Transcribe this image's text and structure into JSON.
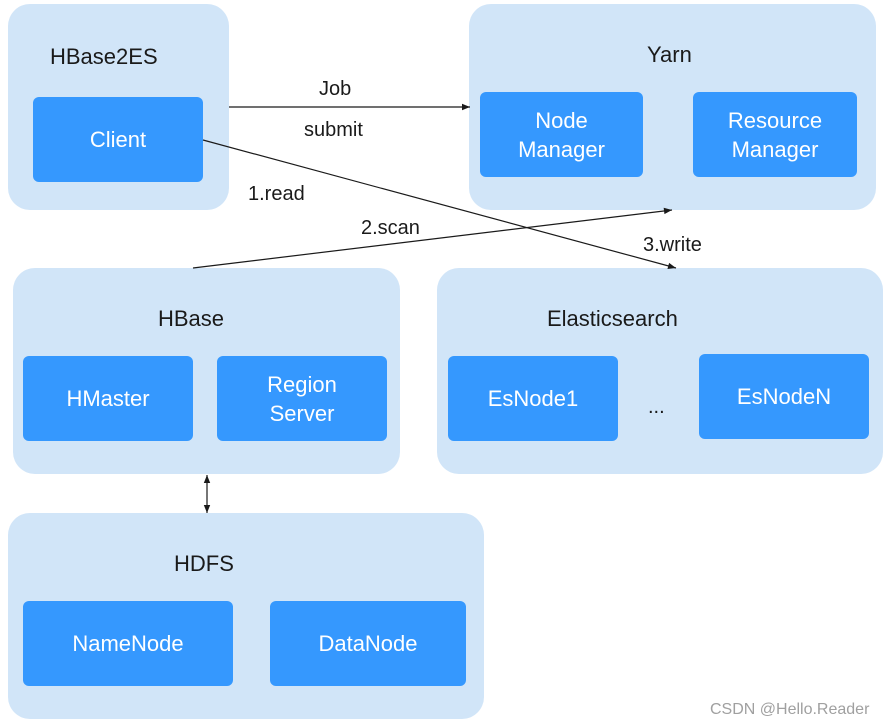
{
  "colors": {
    "group_fill": "#d1e5f8",
    "node_fill": "#3598fe",
    "node_text": "#ffffff",
    "title_text": "#1a1a1a",
    "edge": "#1a1a1a",
    "watermark": "#a0a0a0"
  },
  "groups": {
    "hbase2es": {
      "title": "HBase2ES",
      "nodes": [
        "Client"
      ]
    },
    "yarn": {
      "title": "Yarn",
      "nodes": [
        "Node\nManager",
        "Resource\nManager"
      ]
    },
    "hbase": {
      "title": "HBase",
      "nodes": [
        "HMaster",
        "Region\nServer"
      ]
    },
    "elasticsearch": {
      "title": "Elasticsearch",
      "nodes": [
        "EsNode1",
        "EsNodeN"
      ],
      "ellipsis": "..."
    },
    "hdfs": {
      "title": "HDFS",
      "nodes": [
        "NameNode",
        "DataNode"
      ]
    }
  },
  "edges": [
    {
      "from": "Client",
      "to": "Yarn",
      "label_above": "Job",
      "label_below": "submit",
      "direction": "forward"
    },
    {
      "from": "Client",
      "to": "Elasticsearch",
      "label": "1.read / 3.write",
      "direction": "forward"
    },
    {
      "from": "HBase",
      "to": "Yarn",
      "label": "2.scan",
      "direction": "forward"
    },
    {
      "from": "HBase",
      "to": "HDFS",
      "label": "",
      "direction": "bidirectional"
    }
  ],
  "edge_labels": {
    "job": "Job",
    "submit": "submit",
    "read": "1.read",
    "scan": "2.scan",
    "write": "3.write"
  },
  "watermark": "CSDN @Hello.Reader"
}
